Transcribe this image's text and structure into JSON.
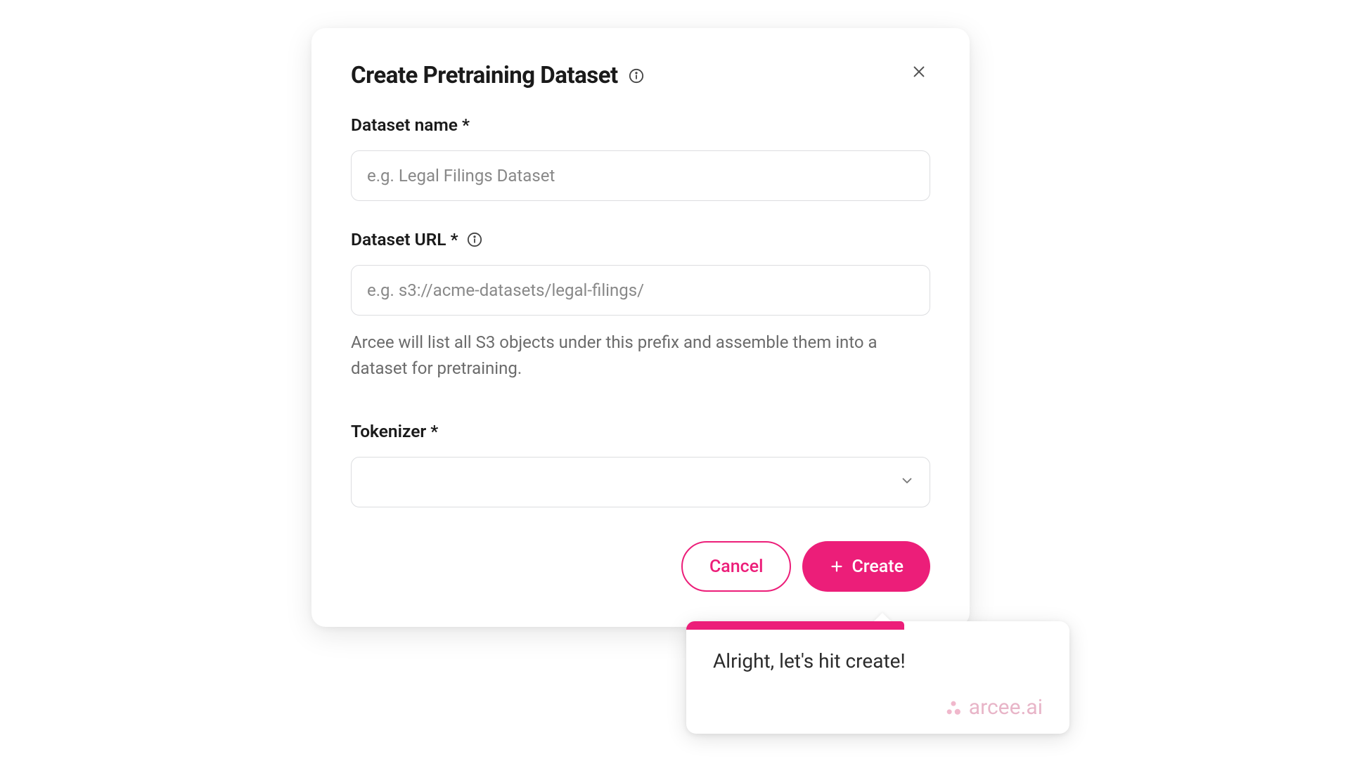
{
  "modal": {
    "title": "Create Pretraining Dataset",
    "fields": {
      "name": {
        "label": "Dataset name *",
        "placeholder": "e.g. Legal Filings Dataset",
        "value": ""
      },
      "url": {
        "label": "Dataset URL *",
        "placeholder": "e.g. s3://acme-datasets/legal-filings/",
        "value": "",
        "help": "Arcee will list all S3 objects under this prefix and assemble them into a dataset for pretraining."
      },
      "tokenizer": {
        "label": "Tokenizer *",
        "value": ""
      }
    },
    "buttons": {
      "cancel": "Cancel",
      "create": "Create"
    }
  },
  "tooltip": {
    "text": "Alright, let's hit create!",
    "brand": "arcee.ai"
  },
  "colors": {
    "accent": "#ec1e79"
  }
}
